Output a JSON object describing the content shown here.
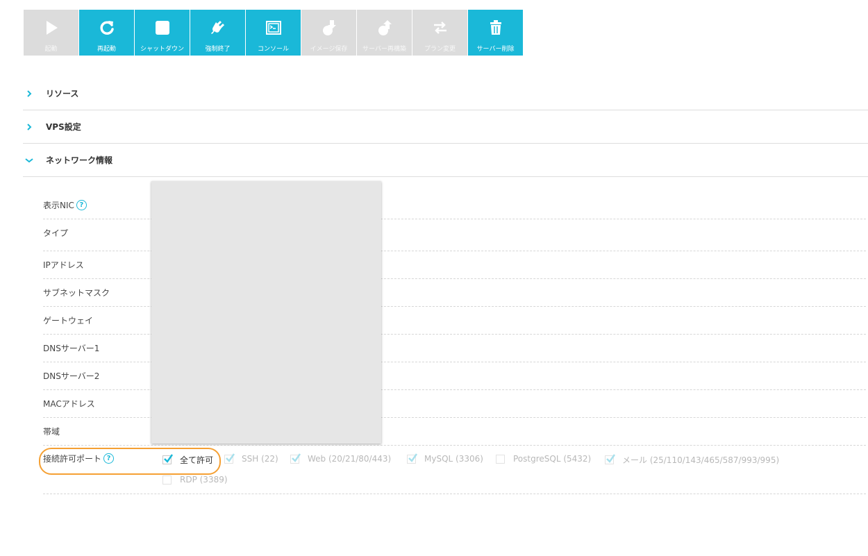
{
  "toolbar": {
    "buttons": [
      {
        "label": "起動",
        "icon": "play-icon",
        "state": "disabled"
      },
      {
        "label": "再起動",
        "icon": "restart-icon",
        "state": "active"
      },
      {
        "label": "シャットダウン",
        "icon": "stop-icon",
        "state": "active"
      },
      {
        "label": "強制終了",
        "icon": "plug-icon",
        "state": "active"
      },
      {
        "label": "コンソール",
        "icon": "console-icon",
        "state": "active"
      },
      {
        "label": "イメージ保存",
        "icon": "image-save-icon",
        "state": "disabled"
      },
      {
        "label": "サーバー再構築",
        "icon": "server-rebuild-icon",
        "state": "disabled"
      },
      {
        "label": "プラン変更",
        "icon": "swap-arrows-icon",
        "state": "disabled"
      },
      {
        "label": "サーバー削除",
        "icon": "trash-icon",
        "state": "active"
      }
    ]
  },
  "sections": [
    {
      "title": "リソース",
      "expanded": false
    },
    {
      "title": "VPS設定",
      "expanded": false
    },
    {
      "title": "ネットワーク情報",
      "expanded": true
    }
  ],
  "network": {
    "rows": [
      {
        "label": "表示NIC",
        "help": true
      },
      {
        "label": "タイプ",
        "help": false
      },
      {
        "label": "IPアドレス",
        "help": false
      },
      {
        "label": "サブネットマスク",
        "help": false
      },
      {
        "label": "ゲートウェイ",
        "help": false
      },
      {
        "label": "DNSサーバー1",
        "help": false
      },
      {
        "label": "DNSサーバー2",
        "help": false
      },
      {
        "label": "MACアドレス",
        "help": false
      },
      {
        "label": "帯域",
        "help": false
      }
    ],
    "ports": {
      "label": "接続許可ポート",
      "help": true,
      "options": [
        {
          "label": "全て許可",
          "checked": true,
          "enabled": true
        },
        {
          "label": "SSH (22)",
          "checked": true,
          "enabled": false
        },
        {
          "label": "Web (20/21/80/443)",
          "checked": true,
          "enabled": false
        },
        {
          "label": "MySQL (3306)",
          "checked": true,
          "enabled": false
        },
        {
          "label": "PostgreSQL (5432)",
          "checked": false,
          "enabled": false
        },
        {
          "label": "メール (25/110/143/465/587/993/995)",
          "checked": true,
          "enabled": false
        },
        {
          "label": "RDP (3389)",
          "checked": false,
          "enabled": false
        }
      ]
    }
  },
  "help_glyph": "?",
  "colors": {
    "accent": "#1ab8d8",
    "disabled": "#dcdcdc",
    "highlight": "#f5a033"
  }
}
